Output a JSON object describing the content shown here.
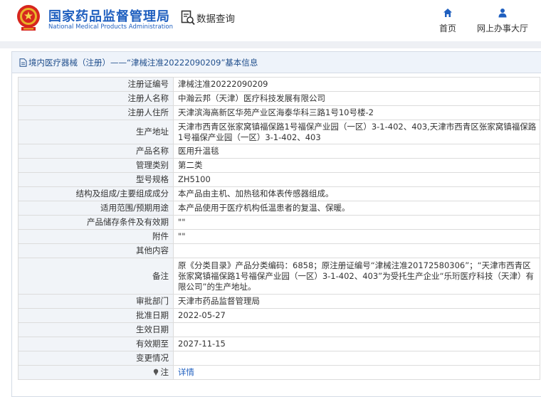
{
  "header": {
    "brand_cn": "国家药品监督管理局",
    "brand_en": "National Medical Products Administration",
    "query_label": "数据查询",
    "nav": {
      "home": "首页",
      "office": "网上办事大厅"
    }
  },
  "panel": {
    "title": "境内医疗器械（注册）——“津械注准20222090209”基本信息"
  },
  "rows": [
    {
      "label": "注册证编号",
      "value": "津械注准20222090209"
    },
    {
      "label": "注册人名称",
      "value": "中瀚云邦（天津）医疗科技发展有限公司"
    },
    {
      "label": "注册人住所",
      "value": "天津滨海高新区华苑产业区海泰华科三路1号10号楼-2"
    },
    {
      "label": "生产地址",
      "value": "天津市西青区张家窝镇福保路1号福保产业园（一区）3-1-402、403,天津市西青区张家窝镇福保路1号福保产业园（一区）3-1-402、403"
    },
    {
      "label": "产品名称",
      "value": "医用升温毯"
    },
    {
      "label": "管理类别",
      "value": "第二类"
    },
    {
      "label": "型号规格",
      "value": "ZH5100"
    },
    {
      "label": "结构及组成/主要组成成分",
      "value": "本产品由主机、加热毯和体表传感器组成。"
    },
    {
      "label": "适用范围/预期用途",
      "value": "本产品使用于医疗机构低温患者的复温、保暖。"
    },
    {
      "label": "产品储存条件及有效期",
      "value": "\"\""
    },
    {
      "label": "附件",
      "value": "\"\""
    },
    {
      "label": "其他内容",
      "value": ""
    },
    {
      "label": "备注",
      "value": "原《分类目录》产品分类编码：6858；原注册证编号“津械注准20172580306”；“天津市西青区张家窝镇福保路1号福保产业园（一区）3-1-402、403”为受托生产企业“乐珩医疗科技（天津）有限公司”的生产地址。"
    },
    {
      "label": "审批部门",
      "value": "天津市药品监督管理局"
    },
    {
      "label": "批准日期",
      "value": "2022-05-27"
    },
    {
      "label": "生效日期",
      "value": ""
    },
    {
      "label": "有效期至",
      "value": "2027-11-15"
    },
    {
      "label": "变更情况",
      "value": ""
    }
  ],
  "note_row": {
    "label": "注",
    "link": "详情"
  },
  "colors": {
    "brand_blue": "#1f5fbf",
    "emblem_red": "#d7261e",
    "label_bg": "#f1f4f8"
  }
}
